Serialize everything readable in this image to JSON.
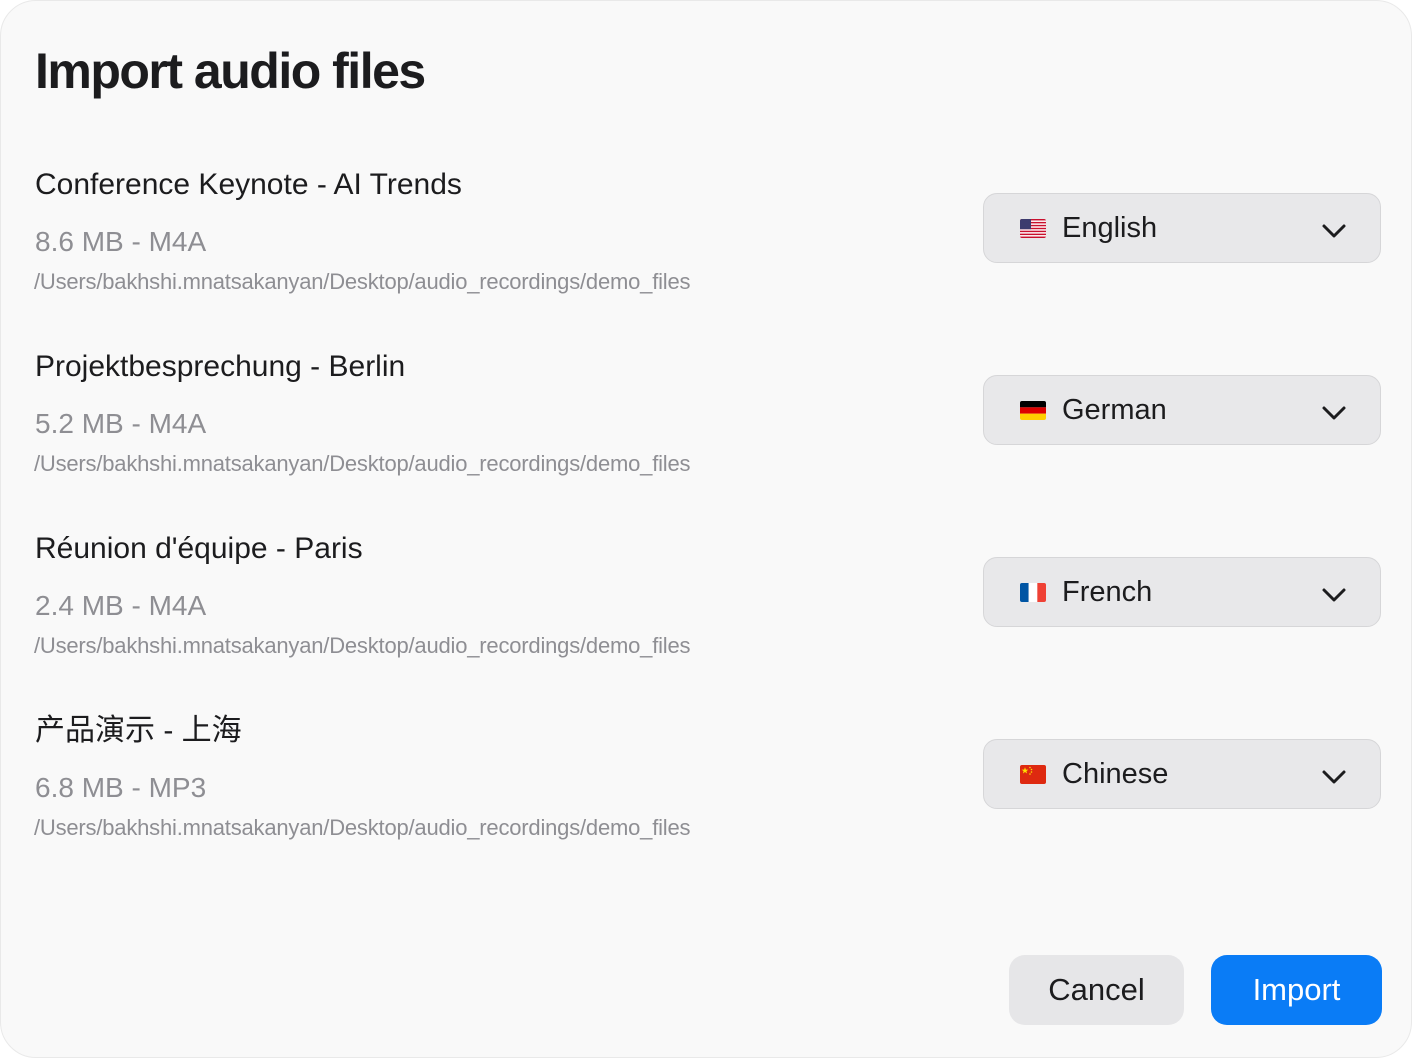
{
  "dialog": {
    "title": "Import audio files",
    "cancel_label": "Cancel",
    "import_label": "Import"
  },
  "files": [
    {
      "name": "Conference Keynote - AI Trends",
      "meta": "8.6 MB - M4A",
      "path": "/Users/bakhshi.mnatsakanyan/Desktop/audio_recordings/demo_files",
      "language": "English",
      "flag_icon": "us-flag-icon"
    },
    {
      "name": "Projektbesprechung - Berlin",
      "meta": "5.2 MB - M4A",
      "path": "/Users/bakhshi.mnatsakanyan/Desktop/audio_recordings/demo_files",
      "language": "German",
      "flag_icon": "de-flag-icon"
    },
    {
      "name": "Réunion d'équipe - Paris",
      "meta": "2.4 MB - M4A",
      "path": "/Users/bakhshi.mnatsakanyan/Desktop/audio_recordings/demo_files",
      "language": "French",
      "flag_icon": "fr-flag-icon"
    },
    {
      "name": "产品演示 - 上海",
      "meta": "6.8 MB - MP3",
      "path": "/Users/bakhshi.mnatsakanyan/Desktop/audio_recordings/demo_files",
      "language": "Chinese",
      "flag_icon": "cn-flag-icon"
    }
  ],
  "colors": {
    "accent": "#0a7cf6",
    "text_primary": "#1c1c1e",
    "text_secondary": "#8e8e93",
    "select_background": "#e8e8ea"
  }
}
